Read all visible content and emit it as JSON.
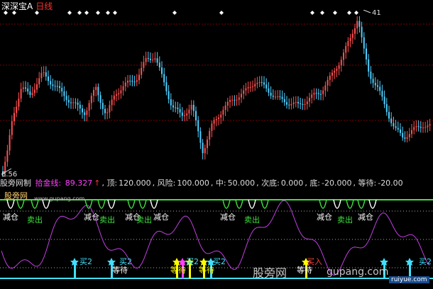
{
  "title": {
    "symbol": "深深宝A",
    "period": "日线"
  },
  "price_labels": {
    "high": "41",
    "low": "8.56"
  },
  "indicator": {
    "name": "股旁网制",
    "line_name": "拾金线:",
    "line_value": "89.327",
    "params": [
      {
        "label": "顶:",
        "value": "120.000"
      },
      {
        "label": "风险:",
        "value": "100.000"
      },
      {
        "label": "中:",
        "value": "50.000"
      },
      {
        "label": "次底:",
        "value": "0.000"
      },
      {
        "label": "底:",
        "value": "-20.000"
      },
      {
        "label": "等待:",
        "value": "-20.00"
      }
    ]
  },
  "signals": {
    "buy2": "买2",
    "wait": "等待",
    "sell": "卖出",
    "reduce": "减仓",
    "buy_in": "买入"
  },
  "watermarks": {
    "brand_small": "股旁网",
    "url_small": "www.gupang.com",
    "brand_large": "股旁网",
    "url_large": "gupang.com",
    "site_badge": "ruiyue.com"
  },
  "colors": {
    "up": "#ff5050",
    "down": "#50d0ff",
    "purple": "#c040e0",
    "green": "#40e040",
    "cyan": "#40e0ff",
    "yellow": "#ffff00",
    "magenta": "#ff40ff",
    "dark_red_grid": "#7a0000"
  }
}
